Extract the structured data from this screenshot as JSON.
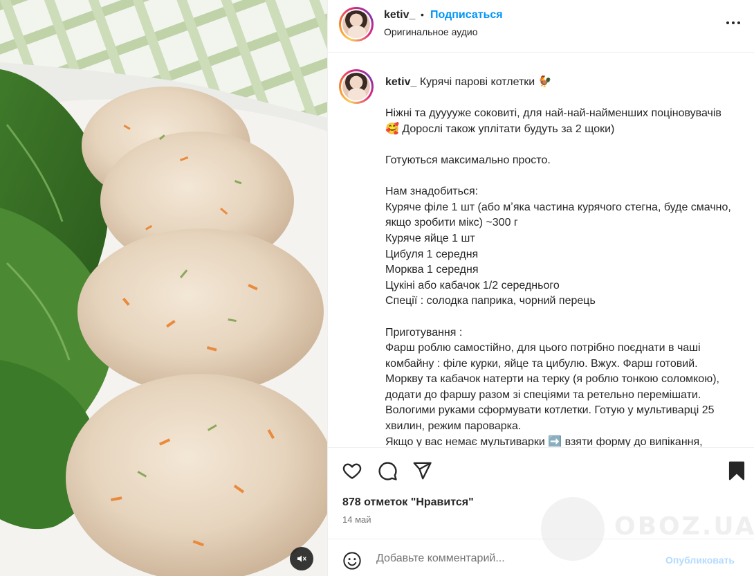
{
  "header": {
    "username": "ketiv_",
    "separator": "•",
    "follow_label": "Подписаться",
    "audio_label": "Оригинальное аудио",
    "more_icon": "more-horizontal-icon"
  },
  "caption": {
    "username": "ketiv_",
    "text": " Курячі парові котлетки 🐓\n\nНіжні та дууууже соковиті, для най-най-найменших поціновувачів 🥰 Дорослі також уплітати будуть за 2 щоки)\n\nГотуються максимально просто.\n\nНам знадобиться:\nКуряче філе 1 шт (або мʼяка частина курячого стегна, буде смачно, якщо зробити мікс) ~300 г\nКуряче яйце 1 шт\nЦибуля 1 середня\nМорква 1 середня\nЦукіні або кабачок 1/2 середнього\nСпеції : солодка паприка, чорний перець\n\nПриготування :\nФарш роблю самостійно, для цього потрібно поєднати в чаші комбайну : філе курки, яйце та цибулю. Вжух. Фарш готовий.\nМоркву та кабачок натерти на терку (я роблю тонкою соломкою), додати до фаршу разом зі спеціями та ретельно перемішати. Вологими руками сформувати котлетки. Готую у мультиварці 25 хвилин, режим пароварка.\nЯкщо у вас немає мультиварки ➡️ взяти форму до випікання,"
  },
  "actions": {
    "like_icon": "heart-icon",
    "comment_icon": "comment-icon",
    "share_icon": "send-icon",
    "save_icon": "bookmark-icon",
    "likes_text": "878 отметок \"Нравится\"",
    "date": "14 май"
  },
  "comment": {
    "placeholder": "Добавьте комментарий...",
    "publish_label": "Опубликовать",
    "emoji_icon": "smiley-icon"
  },
  "media": {
    "mute_icon": "speaker-muted-icon"
  },
  "watermark": {
    "text": "OBOZ.UA"
  },
  "colors": {
    "link_blue": "#0095f6",
    "publish_disabled": "#b3dbff",
    "text": "#262626",
    "secondary_text": "#737373"
  }
}
